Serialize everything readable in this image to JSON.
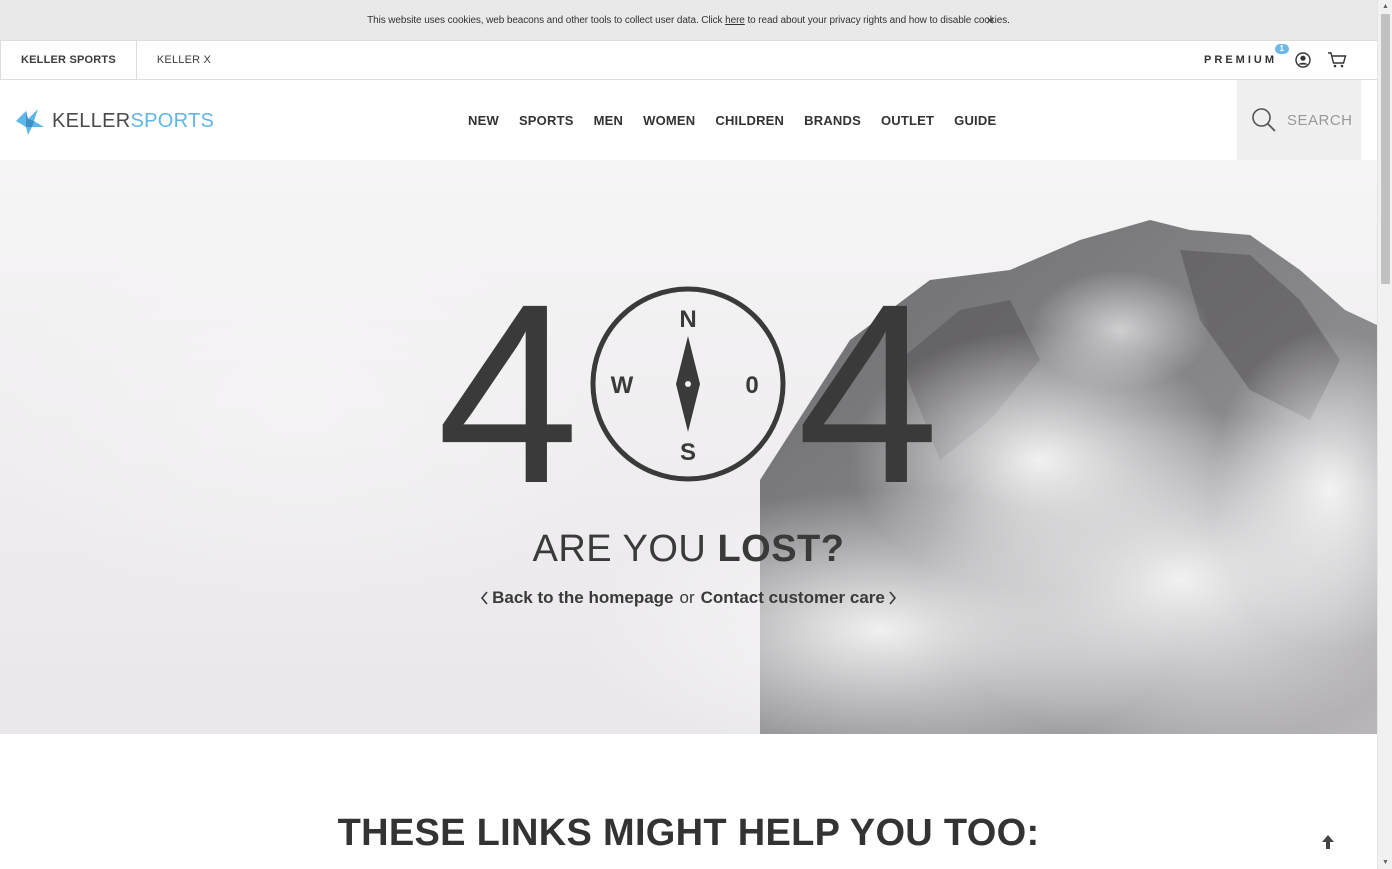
{
  "cookie_bar": {
    "text_before": "This website uses cookies, web beacons and other tools to collect user data. Click ",
    "link_text": "here",
    "text_after": " to read about your privacy rights and how to disable cookies.",
    "close_symbol": "×"
  },
  "top_bar": {
    "tabs": [
      {
        "label": "KELLER SPORTS",
        "active": true
      },
      {
        "label": "KELLER X",
        "active": false
      }
    ],
    "premium_label": "PREMIUM",
    "premium_badge": "1",
    "icons": [
      "user-icon",
      "cart-icon"
    ]
  },
  "header": {
    "logo_part1": "KELLER",
    "logo_part2": "SPORTS",
    "nav_items": [
      "NEW",
      "SPORTS",
      "MEN",
      "WOMEN",
      "CHILDREN",
      "BRANDS",
      "OUTLET",
      "GUIDE"
    ],
    "search_placeholder": "SEARCH"
  },
  "hero": {
    "code_left": "4",
    "code_right": "4",
    "compass": {
      "north": "N",
      "south": "S",
      "west": "W",
      "east": "0"
    },
    "lost_light": "ARE YOU ",
    "lost_bold": "LOST?",
    "back_link": "Back to the homepage",
    "or_text": "or",
    "contact_link": "Contact customer care"
  },
  "section": {
    "title": "THESE LINKS MIGHT HELP YOU TOO:"
  },
  "colors": {
    "accent": "#5fb6e8",
    "text_dark": "#3a3a3a",
    "cookie_bg": "#e9e9e9",
    "search_bg": "#f0f0f0"
  }
}
